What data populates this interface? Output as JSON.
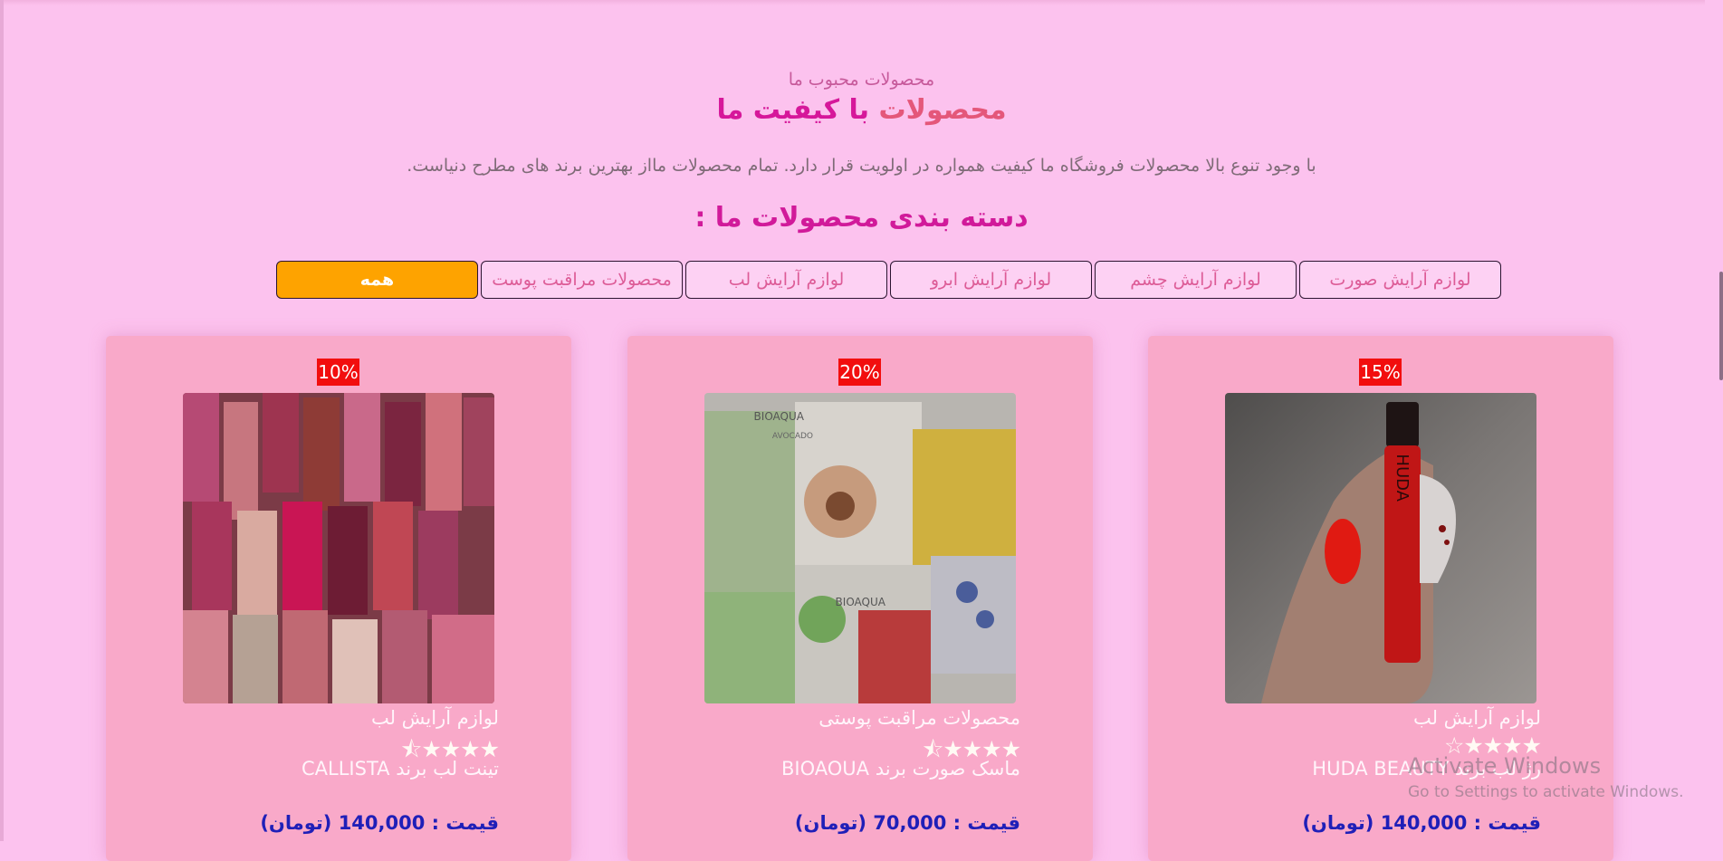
{
  "section": {
    "subtitle": "محصولات محبوب ما",
    "title_part1": "محصولات",
    "title_part2": "با کیفیت ما",
    "description": "با وجود تنوع بالا محصولات فروشگاه ما کیفیت همواره در اولویت قرار دارد. تمام محصولات مااز بهترین برند های مطرح دنیاست.",
    "category_heading": "دسته بندی محصولات ما :"
  },
  "filters": [
    "لوازم آرایش صورت",
    "لوازم آرایش چشم",
    "لوازم آرایش ابرو",
    "لوازم آرایش لب",
    "محصولات مراقبت پوست",
    "همه"
  ],
  "active_filter": "همه",
  "products": [
    {
      "discount": "15%",
      "category": "لوازم آرایش لب",
      "rating_stars": "★★★★☆",
      "name": "رژ لب برند HUDA BEAUTY",
      "price": "قیمت : 140,000 (تومان)"
    },
    {
      "discount": "20%",
      "category": "محصولات مراقبت پوستی",
      "rating_stars": "★★★★⯪",
      "name": "ماسک صورت برند BIOAOUA",
      "price": "قیمت : 70,000 (تومان)"
    },
    {
      "discount": "10%",
      "category": "لوازم آرایش لب",
      "rating_stars": "★★★★⯪",
      "name": "تینت لب برند CALLISTA",
      "price": "قیمت : 140,000 (تومان)"
    }
  ],
  "product_image_text": {
    "bioaqua_1": "BIOAQUA",
    "bioaqua_2": "AVOCADO",
    "bioaqua_3": "BIOAQUA",
    "huda": "HUDA"
  },
  "watermark": {
    "line1": "Activate Windows",
    "line2": "Go to Settings to activate Windows."
  },
  "colors": {
    "background": "#fcc2ee",
    "card": "#f9a9c9",
    "active_filter": "#fea300",
    "badge": "#f20e0e",
    "price": "#1f1fb8",
    "title_accent": "#e4577a",
    "title_main": "#d6179a"
  }
}
